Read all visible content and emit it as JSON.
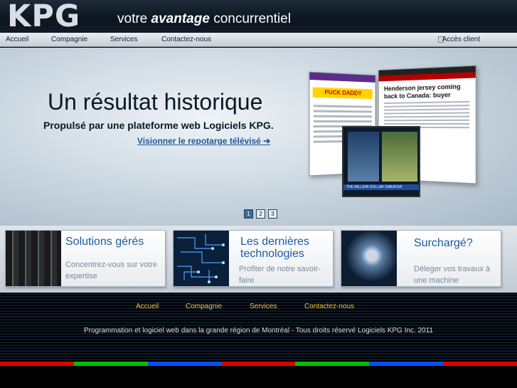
{
  "header": {
    "logo_text": "KPG",
    "tagline_prefix": "votre",
    "tagline_bold": "avantage",
    "tagline_suffix": "concurrentiel"
  },
  "nav": {
    "items": [
      "Accueil",
      "Compagnie",
      "Services",
      "Contactez-nous"
    ],
    "client_access": "Accès client"
  },
  "hero": {
    "title": "Un résultat historique",
    "subtitle": "Propulsé par une plateforme web Logiciels KPG.",
    "link": "Visionner le repotarge télévisé ➔",
    "screenshot_left_banner": "PUCK DADDY",
    "screenshot_right_headline": "Henderson jersey coming back to Canada: buyer",
    "tv_ticker": "THE MILLION DOLLAR SWEATER",
    "pages": [
      "1",
      "2",
      "3"
    ],
    "active_page": 1
  },
  "cards": [
    {
      "title": "Solutions gérés",
      "text": "Concentrez-vous sur votre expertise"
    },
    {
      "title": "Les dernières technologies",
      "text": "Profiter de notre savoir-faire"
    },
    {
      "title": "Surchargé?",
      "text": "Déleger vos travaux à une machine"
    }
  ],
  "footer": {
    "nav": [
      "Accueil",
      "Compagnie",
      "Services",
      "Contactez-nous"
    ],
    "copyright": "Programmation et logiciel web dans la grande région de Montréal - Tous droits réservé Logiciels KPG Inc. 2011"
  },
  "colors": {
    "accent_blue": "#1c5aa3",
    "footer_link": "#f0c040",
    "stripes": [
      "#e00000",
      "#00c000",
      "#0050ff",
      "#e00000",
      "#00c000",
      "#0050ff",
      "#e00000"
    ]
  }
}
